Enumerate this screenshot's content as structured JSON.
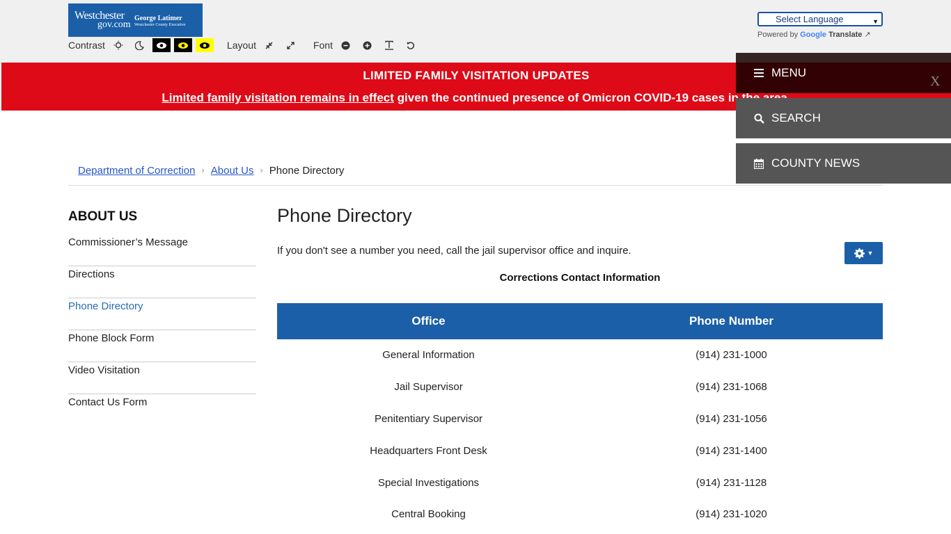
{
  "header": {
    "logo": {
      "line1": "Westchester",
      "line2": "gov.com",
      "exec_name": "George Latimer",
      "exec_title": "Westchester County Executive"
    },
    "toolbar": {
      "contrast_label": "Contrast",
      "layout_label": "Layout",
      "font_label": "Font"
    },
    "translate": {
      "select_label": "Select Language",
      "powered_by": "Powered by",
      "google": "Google",
      "translate": "Translate"
    }
  },
  "alert": {
    "heading": "LIMITED FAMILY VISITATION UPDATES",
    "link_text": "Limited family visitation remains in effect",
    "rest_text": " given the continued presence of Omicron COVID-19 cases in the area."
  },
  "menu_panel": {
    "menu": "MENU",
    "search": "SEARCH",
    "county_news": "COUNTY NEWS",
    "close": "X"
  },
  "breadcrumb": {
    "items": [
      "Department of Correction",
      "About Us",
      "Phone Directory"
    ]
  },
  "sidebar": {
    "heading": "ABOUT US",
    "items": [
      {
        "label": "Commissioner’s Message"
      },
      {
        "label": "Directions"
      },
      {
        "label": "Phone Directory"
      },
      {
        "label": "Phone Block Form"
      },
      {
        "label": "Video Visitation"
      },
      {
        "label": "Contact Us Form"
      }
    ]
  },
  "main": {
    "title": "Phone Directory",
    "intro": "If you don't see a number you need, call the jail supervisor office and inquire.",
    "table_caption": "Corrections Contact Information",
    "columns": [
      "Office",
      "Phone Number"
    ],
    "rows": [
      [
        "General Information",
        "(914) 231-1000"
      ],
      [
        "Jail Supervisor",
        "(914) 231-1068"
      ],
      [
        "Penitentiary Supervisor",
        "(914) 231-1056"
      ],
      [
        "Headquarters Front Desk",
        "(914) 231-1400"
      ],
      [
        "Special Investigations",
        "(914) 231-1128"
      ],
      [
        "Central Booking",
        "(914) 231-1020"
      ]
    ]
  },
  "colors": {
    "brand_blue": "#1b5fa8",
    "alert_red": "#de0a17",
    "link_blue": "#2757c8"
  }
}
